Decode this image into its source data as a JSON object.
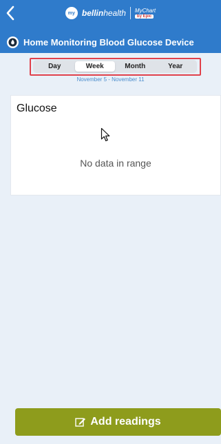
{
  "nav": {
    "brand_prefix": "my",
    "brand_name_bold": "bellin",
    "brand_name_rest": "health",
    "mychart_top": "MyChart",
    "mychart_bottom": "by Epic"
  },
  "header": {
    "title": "Home Monitoring Blood Glucose Device"
  },
  "range_tabs": {
    "items": [
      "Day",
      "Week",
      "Month",
      "Year"
    ],
    "selected": "Week"
  },
  "date_range": "November 5 - November 11",
  "glucose_card": {
    "title": "Glucose",
    "empty_message": "No data in range"
  },
  "add_button": {
    "label": "Add readings"
  },
  "colors": {
    "header_blue": "#2f7bcb",
    "page_background": "#e9f0f8",
    "button_olive": "#8e9c1c",
    "highlight_red": "#e0404a"
  }
}
